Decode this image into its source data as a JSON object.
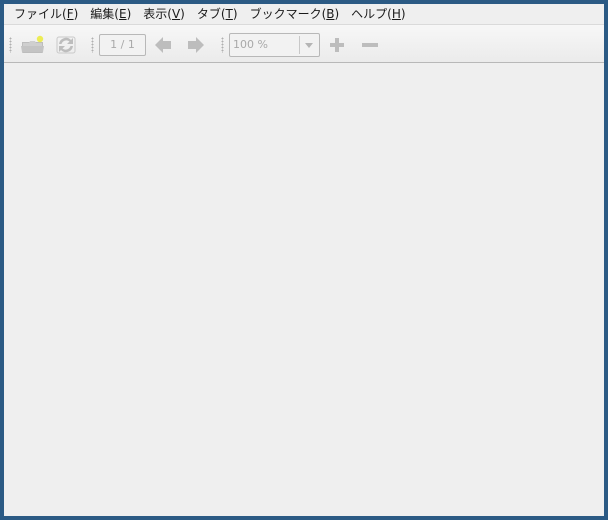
{
  "menubar": {
    "items": [
      {
        "label": "ファイル(",
        "mnemonic": "F",
        "suffix": ")"
      },
      {
        "label": "編集(",
        "mnemonic": "E",
        "suffix": ")"
      },
      {
        "label": "表示(",
        "mnemonic": "V",
        "suffix": ")"
      },
      {
        "label": "タブ(",
        "mnemonic": "T",
        "suffix": ")"
      },
      {
        "label": "ブックマーク(",
        "mnemonic": "B",
        "suffix": ")"
      },
      {
        "label": "ヘルプ(",
        "mnemonic": "H",
        "suffix": ")"
      }
    ]
  },
  "toolbar": {
    "open_icon": "folder-open-icon",
    "reload_icon": "reload-icon",
    "page_indicator": "1 / 1",
    "prev_icon": "arrow-left-icon",
    "next_icon": "arrow-right-icon",
    "zoom_value": "100 %",
    "zoom_in_icon": "plus-icon",
    "zoom_out_icon": "minus-icon"
  },
  "colors": {
    "desktop": "#2b5a84",
    "window_bg": "#efefef",
    "disabled_icon": "#bdbdbd",
    "disabled_text": "#a9a9a9"
  }
}
